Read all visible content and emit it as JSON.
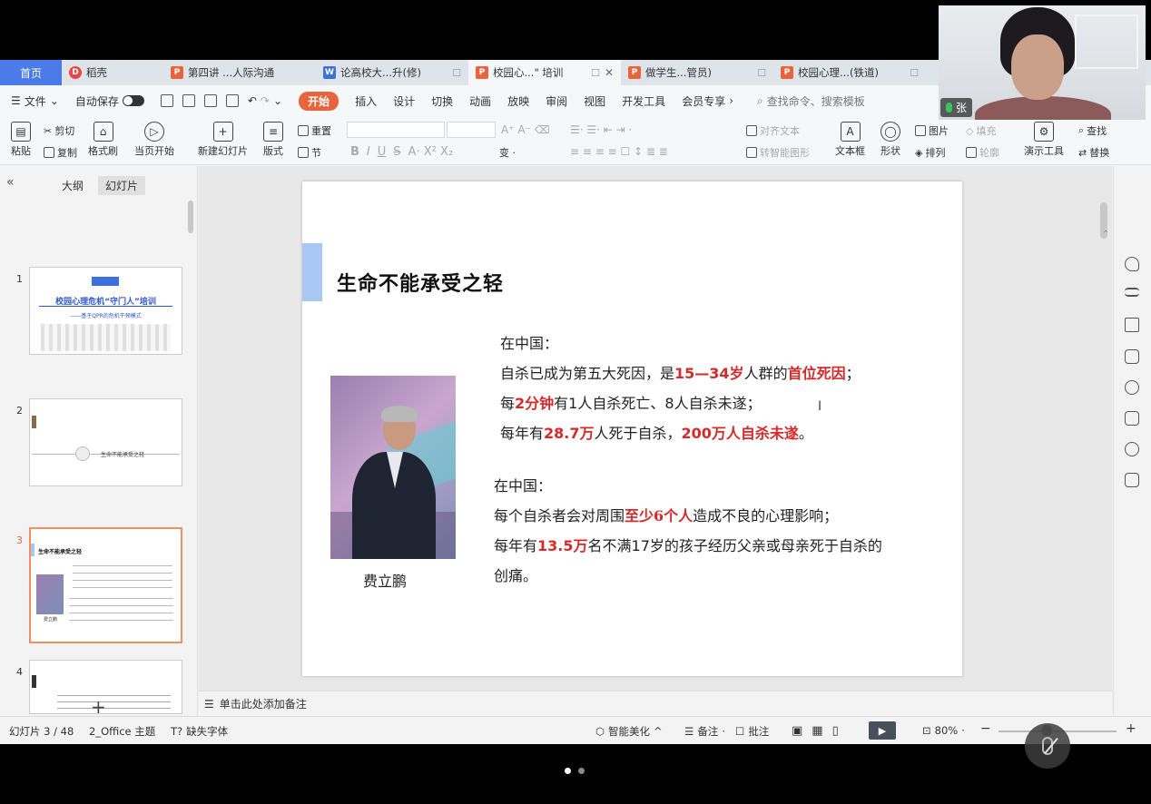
{
  "tabs": {
    "home": "首页",
    "items": [
      {
        "label": "稻壳",
        "icon": "r"
      },
      {
        "label": "第四讲 ...人际沟通",
        "icon": "p"
      },
      {
        "label": "论高校大...升(修)",
        "icon": "w"
      },
      {
        "label": "校园心...\" 培训",
        "icon": "p"
      },
      {
        "label": "做学生...管员)",
        "icon": "p"
      },
      {
        "label": "校园心理...(铁道)",
        "icon": "p"
      }
    ]
  },
  "menu": {
    "file": "文件",
    "autosave": "自动保存",
    "items": [
      "开始",
      "插入",
      "设计",
      "切换",
      "动画",
      "放映",
      "审阅",
      "视图",
      "开发工具",
      "会员专享"
    ],
    "search_placeholder": "查找命令、搜索模板"
  },
  "ribbon": {
    "paste": "粘贴",
    "cut": "剪切",
    "copy": "复制",
    "format_painter": "格式刷",
    "from_current": "当页开始",
    "new_slide": "新建幻灯片",
    "layout": "版式",
    "section": "节",
    "reset": "重置",
    "align_text": "对齐文本",
    "smart_shape": "转智能图形",
    "textbox": "文本框",
    "shape": "形状",
    "picture": "图片",
    "fill": "填充",
    "arrange": "排列",
    "outline": "轮廓",
    "presentation_tools": "演示工具",
    "find": "查找",
    "replace": "替换"
  },
  "left_panel": {
    "tab_outline": "大纲",
    "tab_slides": "幻灯片",
    "thumbs": [
      {
        "num": "1",
        "title": "校园心理危机“守门人”培训",
        "subtitle": "——基于QPR的危机干预模式"
      },
      {
        "num": "2",
        "title": "生命不能承受之轻"
      },
      {
        "num": "3",
        "title": "生命不能承受之轻",
        "caption": "费立鹏"
      },
      {
        "num": "4"
      }
    ]
  },
  "slide": {
    "title": "生命不能承受之轻",
    "photo_caption": "费立鹏",
    "block1": {
      "heading": "在中国：",
      "l1a": "自杀已成为第五大死因，是",
      "l1b": "15—34岁",
      "l1c": "人群的",
      "l1d": "首位死因",
      "l1e": "；",
      "l2a": "每",
      "l2b": "2分钟",
      "l2c": "有",
      "l2d": "1",
      "l2e": "人自杀死亡、",
      "l2f": "8",
      "l2g": "人自杀未遂；",
      "l3a": "每年有",
      "l3b": "28.7万",
      "l3c": "人死于自杀，",
      "l3d": "200万人自杀未遂",
      "l3e": "。"
    },
    "block2": {
      "heading": "在中国：",
      "l1a": "每个自杀者会对周围",
      "l1b": "至少6个人",
      "l1c": "造成不良的心理影响；",
      "l2a": "每年有",
      "l2b": "13.5万",
      "l2c": "名不满",
      "l2d": "17",
      "l2e": "岁的孩子经历父亲或母亲死于自杀的",
      "l3": "创痛。"
    }
  },
  "notes": {
    "placeholder": "单击此处添加备注"
  },
  "status": {
    "slide_counter": "幻灯片 3 / 48",
    "theme": "2_Office 主题",
    "missing_font": "缺失字体",
    "beautify": "智能美化",
    "notes": "备注",
    "comments": "批注",
    "zoom": "80%"
  },
  "webcam": {
    "name": "张"
  },
  "colors": {
    "accent": "#e8643c",
    "highlight": "#d42a2a",
    "tab_home": "#4a7be8",
    "slide_accent": "#a9c7f4"
  }
}
